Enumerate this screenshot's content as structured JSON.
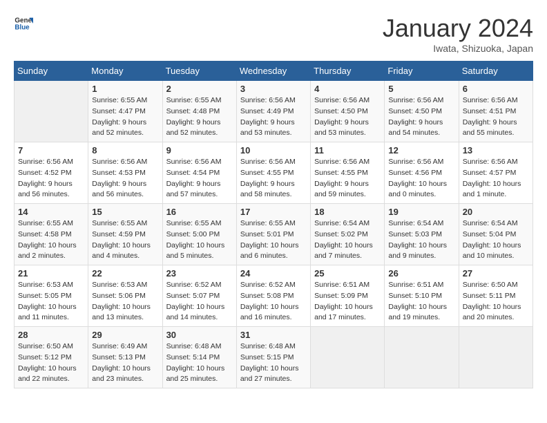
{
  "header": {
    "logo_line1": "General",
    "logo_line2": "Blue",
    "month": "January 2024",
    "location": "Iwata, Shizuoka, Japan"
  },
  "days_of_week": [
    "Sunday",
    "Monday",
    "Tuesday",
    "Wednesday",
    "Thursday",
    "Friday",
    "Saturday"
  ],
  "weeks": [
    [
      {
        "day": "",
        "sunrise": "",
        "sunset": "",
        "daylight": ""
      },
      {
        "day": "1",
        "sunrise": "Sunrise: 6:55 AM",
        "sunset": "Sunset: 4:47 PM",
        "daylight": "Daylight: 9 hours and 52 minutes."
      },
      {
        "day": "2",
        "sunrise": "Sunrise: 6:55 AM",
        "sunset": "Sunset: 4:48 PM",
        "daylight": "Daylight: 9 hours and 52 minutes."
      },
      {
        "day": "3",
        "sunrise": "Sunrise: 6:56 AM",
        "sunset": "Sunset: 4:49 PM",
        "daylight": "Daylight: 9 hours and 53 minutes."
      },
      {
        "day": "4",
        "sunrise": "Sunrise: 6:56 AM",
        "sunset": "Sunset: 4:50 PM",
        "daylight": "Daylight: 9 hours and 53 minutes."
      },
      {
        "day": "5",
        "sunrise": "Sunrise: 6:56 AM",
        "sunset": "Sunset: 4:50 PM",
        "daylight": "Daylight: 9 hours and 54 minutes."
      },
      {
        "day": "6",
        "sunrise": "Sunrise: 6:56 AM",
        "sunset": "Sunset: 4:51 PM",
        "daylight": "Daylight: 9 hours and 55 minutes."
      }
    ],
    [
      {
        "day": "7",
        "sunrise": "Sunrise: 6:56 AM",
        "sunset": "Sunset: 4:52 PM",
        "daylight": "Daylight: 9 hours and 56 minutes."
      },
      {
        "day": "8",
        "sunrise": "Sunrise: 6:56 AM",
        "sunset": "Sunset: 4:53 PM",
        "daylight": "Daylight: 9 hours and 56 minutes."
      },
      {
        "day": "9",
        "sunrise": "Sunrise: 6:56 AM",
        "sunset": "Sunset: 4:54 PM",
        "daylight": "Daylight: 9 hours and 57 minutes."
      },
      {
        "day": "10",
        "sunrise": "Sunrise: 6:56 AM",
        "sunset": "Sunset: 4:55 PM",
        "daylight": "Daylight: 9 hours and 58 minutes."
      },
      {
        "day": "11",
        "sunrise": "Sunrise: 6:56 AM",
        "sunset": "Sunset: 4:55 PM",
        "daylight": "Daylight: 9 hours and 59 minutes."
      },
      {
        "day": "12",
        "sunrise": "Sunrise: 6:56 AM",
        "sunset": "Sunset: 4:56 PM",
        "daylight": "Daylight: 10 hours and 0 minutes."
      },
      {
        "day": "13",
        "sunrise": "Sunrise: 6:56 AM",
        "sunset": "Sunset: 4:57 PM",
        "daylight": "Daylight: 10 hours and 1 minute."
      }
    ],
    [
      {
        "day": "14",
        "sunrise": "Sunrise: 6:55 AM",
        "sunset": "Sunset: 4:58 PM",
        "daylight": "Daylight: 10 hours and 2 minutes."
      },
      {
        "day": "15",
        "sunrise": "Sunrise: 6:55 AM",
        "sunset": "Sunset: 4:59 PM",
        "daylight": "Daylight: 10 hours and 4 minutes."
      },
      {
        "day": "16",
        "sunrise": "Sunrise: 6:55 AM",
        "sunset": "Sunset: 5:00 PM",
        "daylight": "Daylight: 10 hours and 5 minutes."
      },
      {
        "day": "17",
        "sunrise": "Sunrise: 6:55 AM",
        "sunset": "Sunset: 5:01 PM",
        "daylight": "Daylight: 10 hours and 6 minutes."
      },
      {
        "day": "18",
        "sunrise": "Sunrise: 6:54 AM",
        "sunset": "Sunset: 5:02 PM",
        "daylight": "Daylight: 10 hours and 7 minutes."
      },
      {
        "day": "19",
        "sunrise": "Sunrise: 6:54 AM",
        "sunset": "Sunset: 5:03 PM",
        "daylight": "Daylight: 10 hours and 9 minutes."
      },
      {
        "day": "20",
        "sunrise": "Sunrise: 6:54 AM",
        "sunset": "Sunset: 5:04 PM",
        "daylight": "Daylight: 10 hours and 10 minutes."
      }
    ],
    [
      {
        "day": "21",
        "sunrise": "Sunrise: 6:53 AM",
        "sunset": "Sunset: 5:05 PM",
        "daylight": "Daylight: 10 hours and 11 minutes."
      },
      {
        "day": "22",
        "sunrise": "Sunrise: 6:53 AM",
        "sunset": "Sunset: 5:06 PM",
        "daylight": "Daylight: 10 hours and 13 minutes."
      },
      {
        "day": "23",
        "sunrise": "Sunrise: 6:52 AM",
        "sunset": "Sunset: 5:07 PM",
        "daylight": "Daylight: 10 hours and 14 minutes."
      },
      {
        "day": "24",
        "sunrise": "Sunrise: 6:52 AM",
        "sunset": "Sunset: 5:08 PM",
        "daylight": "Daylight: 10 hours and 16 minutes."
      },
      {
        "day": "25",
        "sunrise": "Sunrise: 6:51 AM",
        "sunset": "Sunset: 5:09 PM",
        "daylight": "Daylight: 10 hours and 17 minutes."
      },
      {
        "day": "26",
        "sunrise": "Sunrise: 6:51 AM",
        "sunset": "Sunset: 5:10 PM",
        "daylight": "Daylight: 10 hours and 19 minutes."
      },
      {
        "day": "27",
        "sunrise": "Sunrise: 6:50 AM",
        "sunset": "Sunset: 5:11 PM",
        "daylight": "Daylight: 10 hours and 20 minutes."
      }
    ],
    [
      {
        "day": "28",
        "sunrise": "Sunrise: 6:50 AM",
        "sunset": "Sunset: 5:12 PM",
        "daylight": "Daylight: 10 hours and 22 minutes."
      },
      {
        "day": "29",
        "sunrise": "Sunrise: 6:49 AM",
        "sunset": "Sunset: 5:13 PM",
        "daylight": "Daylight: 10 hours and 23 minutes."
      },
      {
        "day": "30",
        "sunrise": "Sunrise: 6:48 AM",
        "sunset": "Sunset: 5:14 PM",
        "daylight": "Daylight: 10 hours and 25 minutes."
      },
      {
        "day": "31",
        "sunrise": "Sunrise: 6:48 AM",
        "sunset": "Sunset: 5:15 PM",
        "daylight": "Daylight: 10 hours and 27 minutes."
      },
      {
        "day": "",
        "sunrise": "",
        "sunset": "",
        "daylight": ""
      },
      {
        "day": "",
        "sunrise": "",
        "sunset": "",
        "daylight": ""
      },
      {
        "day": "",
        "sunrise": "",
        "sunset": "",
        "daylight": ""
      }
    ]
  ]
}
